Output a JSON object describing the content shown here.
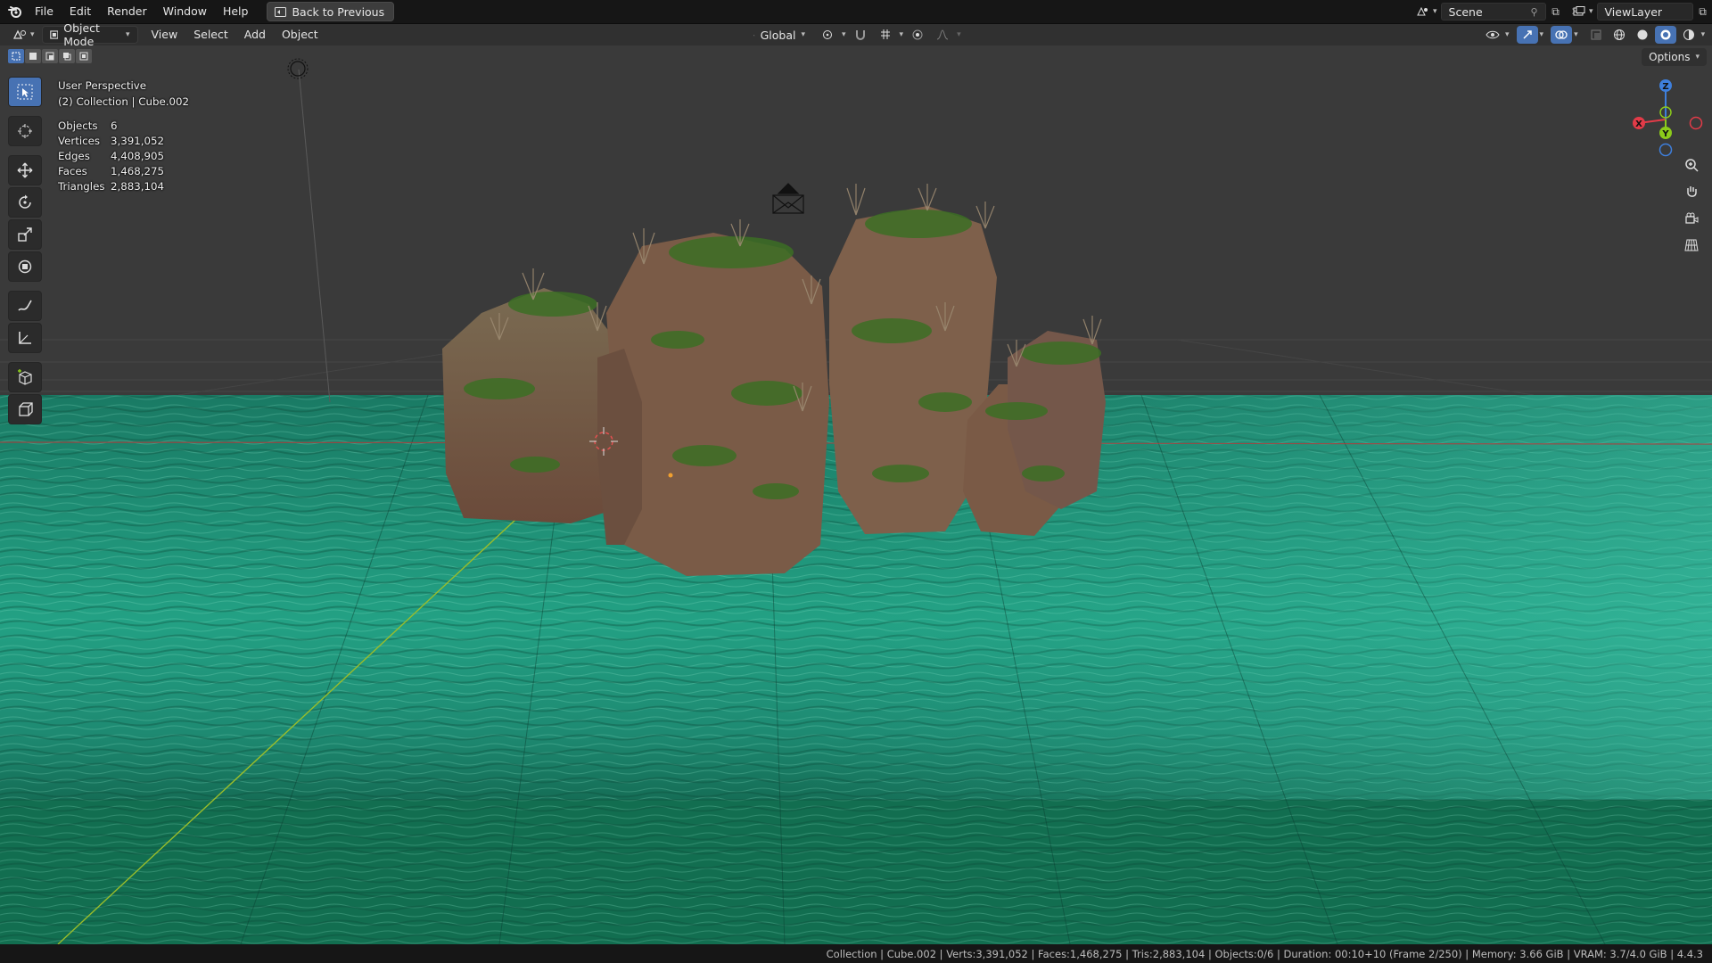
{
  "menubar": {
    "items": [
      "File",
      "Edit",
      "Render",
      "Window",
      "Help"
    ],
    "back_button": "Back to Previous",
    "scene": "Scene",
    "view_layer": "ViewLayer"
  },
  "header": {
    "mode": "Object Mode",
    "menus": [
      "View",
      "Select",
      "Add",
      "Object"
    ],
    "transform_orientation": "Global",
    "options": "Options"
  },
  "viewport": {
    "perspective": "User Perspective",
    "collection": "(2) Collection | Cube.002",
    "stats": [
      {
        "label": "Objects",
        "value": "6"
      },
      {
        "label": "Vertices",
        "value": "3,391,052"
      },
      {
        "label": "Edges",
        "value": "4,408,905"
      },
      {
        "label": "Faces",
        "value": "1,468,275"
      },
      {
        "label": "Triangles",
        "value": "2,883,104"
      }
    ],
    "gizmo_axes": {
      "x": "X",
      "y": "Y",
      "z": "Z"
    }
  },
  "colors": {
    "accent": "#4772b3",
    "water": "#1f8f6f",
    "axis_x": "#e23b48",
    "axis_y": "#8ccb1b",
    "axis_z": "#3e7fdc"
  },
  "statusbar": {
    "text": "Collection | Cube.002 | Verts:3,391,052 | Faces:1,468,275 | Tris:2,883,104 | Objects:0/6 | Duration: 00:10+10 (Frame 2/250) | Memory: 3.66 GiB | VRAM: 3.7/4.0 GiB | 4.4.3"
  }
}
